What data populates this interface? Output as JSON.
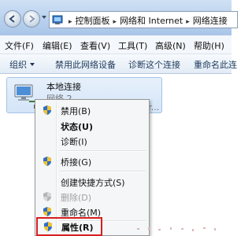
{
  "address": {
    "crumbs": [
      "控制面板",
      "网络和 Internet",
      "网络连接"
    ]
  },
  "menubar": {
    "items": [
      "文件(F)",
      "编辑(E)",
      "查看(V)",
      "工具(T)",
      "高级(N)",
      "帮助(H)"
    ]
  },
  "commandbar": {
    "organize": "组织",
    "disable_device": "禁用此网络设备",
    "diagnose": "诊断这个连接",
    "rename": "重命名此连"
  },
  "connection": {
    "name": "本地连接",
    "status": "网络  2",
    "adapter": "...or..."
  },
  "context_menu": {
    "items": [
      {
        "label": "禁用(B)",
        "icon": "uac-shield-icon",
        "style": "normal"
      },
      {
        "label": "状态(U)",
        "icon": "",
        "style": "bold"
      },
      {
        "label": "诊断(I)",
        "icon": "",
        "style": "normal"
      },
      {
        "label": "桥接(G)",
        "icon": "uac-shield-icon",
        "style": "normal"
      },
      {
        "label": "创建快捷方式(S)",
        "icon": "",
        "style": "normal"
      },
      {
        "label": "删除(D)",
        "icon": "uac-shield-icon",
        "style": "disabled"
      },
      {
        "label": "重命名(M)",
        "icon": "uac-shield-icon",
        "style": "normal"
      },
      {
        "label": "属性(R)",
        "icon": "uac-shield-icon",
        "style": "highlight"
      }
    ]
  },
  "colors": {
    "highlight_border": "#d81e1e",
    "titlebar": "#b9d1ee",
    "tile_selected": "#d4e5f8"
  }
}
